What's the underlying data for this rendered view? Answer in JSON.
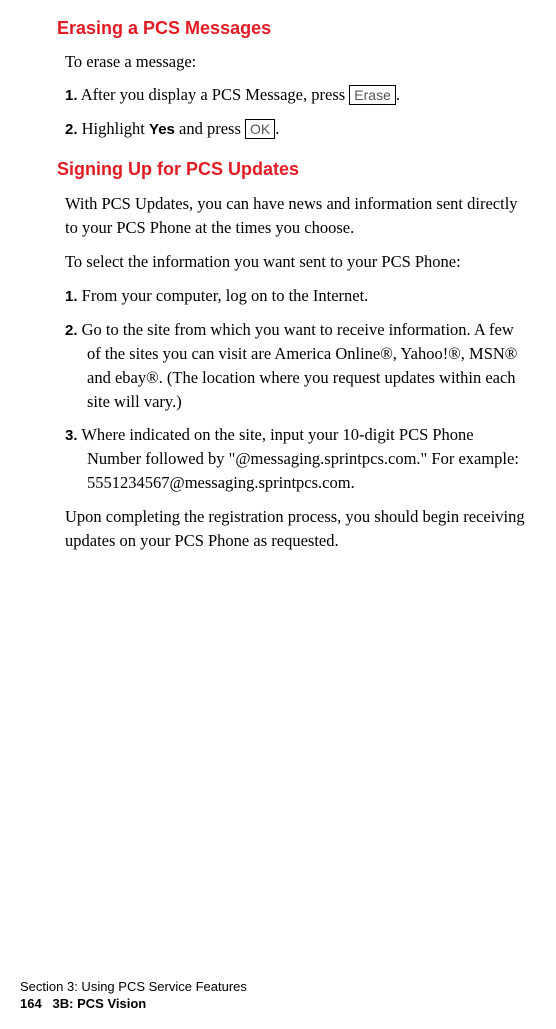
{
  "section1": {
    "heading": "Erasing a PCS Messages",
    "intro": "To erase a message:",
    "steps": [
      {
        "num": "1.",
        "pre": " After you display a PCS Message, press ",
        "key": "Erase",
        "post": "."
      },
      {
        "num": "2.",
        "pre": " Highlight ",
        "bold": "Yes",
        "mid": " and press ",
        "key": "OK",
        "post": "."
      }
    ]
  },
  "section2": {
    "heading": "Signing Up for PCS Updates",
    "para1": "With PCS Updates, you can have news and information sent directly to your PCS Phone at the times you choose.",
    "para2": "To select the information you want sent to your PCS Phone:",
    "steps": [
      {
        "num": "1.",
        "text": " From your computer, log on to the Internet."
      },
      {
        "num": "2.",
        "text": " Go to the site from which you want to receive information. A few of the sites you can visit are America Online®, Yahoo!®, MSN® and ebay®. (The location where you request updates within each site will vary.)"
      },
      {
        "num": "3.",
        "text": " Where indicated on the site, input your 10-digit PCS Phone Number followed by \"@messaging.sprintpcs.com.\" For example: 5551234567@messaging.sprintpcs.com."
      }
    ],
    "para3": "Upon completing the registration process, you should begin receiving updates on your PCS Phone as requested."
  },
  "footer": {
    "line1": "Section 3: Using PCS Service Features",
    "page": "164",
    "rest": "3B: PCS Vision"
  }
}
